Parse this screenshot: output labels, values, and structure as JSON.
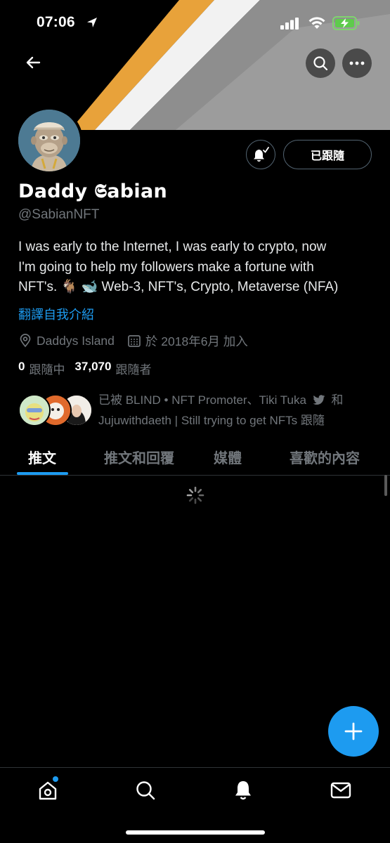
{
  "status_bar": {
    "time": "07:06"
  },
  "profile": {
    "display_name": "Daddy 𝕾abian",
    "handle": "@SabianNFT",
    "bio_line1": "I was early to the Internet, I was early to crypto, now",
    "bio_line2": "I'm going to help my followers make a fortune with",
    "bio_line3": "NFT's. 🐐 🐋 Web-3, NFT's, Crypto, Metaverse (NFA)",
    "translate_label": "翻譯自我介紹",
    "location": "Daddys Island",
    "joined": "於 2018年6月 加入",
    "following_count": "0",
    "following_label": "跟隨中",
    "followers_count": "37,070",
    "followers_label": "跟隨者",
    "followed_by_line1": "已被 BLIND • NFT Promoter、Tiki Tuka",
    "followed_by_connector": "和",
    "followed_by_line2": "Jujuwithdaeth | Still trying to get NFTs 跟隨"
  },
  "actions": {
    "follow_button_label": "已跟隨"
  },
  "tabs": [
    {
      "label": "推文",
      "active": true
    },
    {
      "label": "推文和回覆",
      "active": false
    },
    {
      "label": "媒體",
      "active": false
    },
    {
      "label": "喜歡的內容",
      "active": false
    }
  ],
  "bottom_nav": [
    {
      "icon": "home-icon",
      "has_notification": true
    },
    {
      "icon": "search-icon"
    },
    {
      "icon": "bell-icon"
    },
    {
      "icon": "mail-icon"
    }
  ],
  "colors": {
    "accent": "#1d9bf0",
    "background": "#000000",
    "secondary_text": "#71767b",
    "banner_orange": "#e8a23a"
  }
}
